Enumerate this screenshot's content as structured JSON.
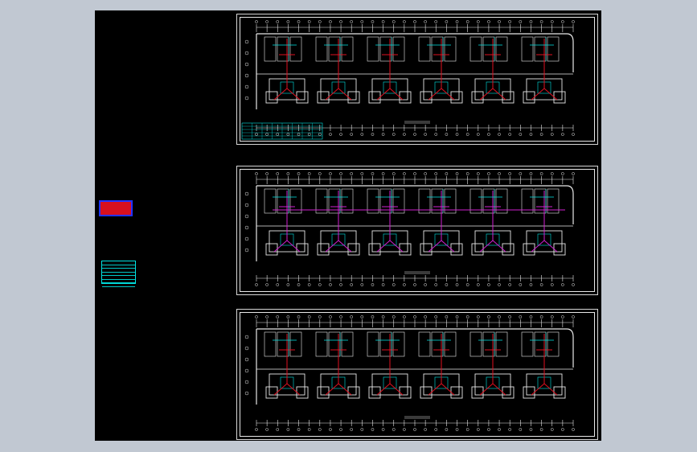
{
  "colors": {
    "background": "#c1c8d2",
    "canvas": "#000000",
    "frame": "#d6d6d6",
    "wall": "#e8e8e8",
    "cyan": "#00e5e5",
    "red": "#e01020",
    "magenta": "#d020d0",
    "blue": "#2233ff"
  },
  "sheets": [
    {
      "id": "sheet-1",
      "pipe_color": "red"
    },
    {
      "id": "sheet-2",
      "pipe_color": "magenta"
    },
    {
      "id": "sheet-3",
      "pipe_color": "red"
    }
  ]
}
